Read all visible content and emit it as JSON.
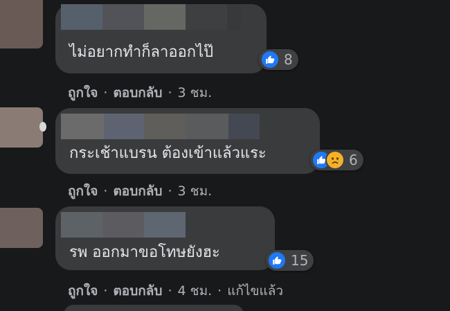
{
  "colors": {
    "page_background": "#18191a",
    "bubble_background": "#3a3b3c",
    "comment_text": "#e4e6eb",
    "meta_text": "#b0b3b8",
    "like_blue": "#2078f4",
    "sad_yellow": "#f7b125"
  },
  "icons": {
    "like": "thumbs-up-icon",
    "sad": "sad-face-icon"
  },
  "comments": [
    {
      "text": "ไม่อยากทำก็ลาออกไป๊",
      "reaction_count": "8",
      "like_label": "ถูกใจ",
      "reply_label": "ตอบกลับ",
      "time": "3 ชม.",
      "edited": ""
    },
    {
      "text": "กระเช้าแบรน ต้องเข้าแล้วแระ",
      "reaction_count": "6",
      "like_label": "ถูกใจ",
      "reply_label": "ตอบกลับ",
      "time": "3 ชม.",
      "edited": ""
    },
    {
      "text": "รพ ออกมาขอโทษยังฮะ",
      "reaction_count": "15",
      "like_label": "ถูกใจ",
      "reply_label": "ตอบกลับ",
      "time": "4 ชม.",
      "edited": "แก้ไขแล้ว"
    }
  ]
}
